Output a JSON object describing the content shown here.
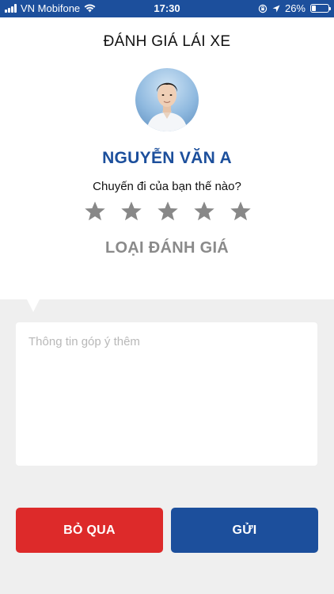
{
  "status_bar": {
    "carrier": "VN Mobifone",
    "time": "17:30",
    "battery_text": "26%",
    "battery_level": 0.26,
    "icons": [
      "signal-icon",
      "wifi-icon",
      "orientation-lock-icon",
      "location-arrow-icon",
      "battery-icon"
    ]
  },
  "page": {
    "title": "ĐÁNH GIÁ LÁI XE"
  },
  "driver": {
    "name": "NGUYỄN VĂN A"
  },
  "rating": {
    "question": "Chuyến đi của bạn thế nào?",
    "stars_total": 5,
    "stars_selected": 0,
    "star_color": "#888888",
    "type_label": "LOẠI ĐÁNH GIÁ"
  },
  "feedback": {
    "placeholder": "Thông tin góp ý thêm",
    "value": ""
  },
  "actions": {
    "skip_label": "BỎ QUA",
    "send_label": "GỬI"
  },
  "colors": {
    "primary": "#1c4f9c",
    "danger": "#dd2a2a",
    "background": "#efefef"
  }
}
